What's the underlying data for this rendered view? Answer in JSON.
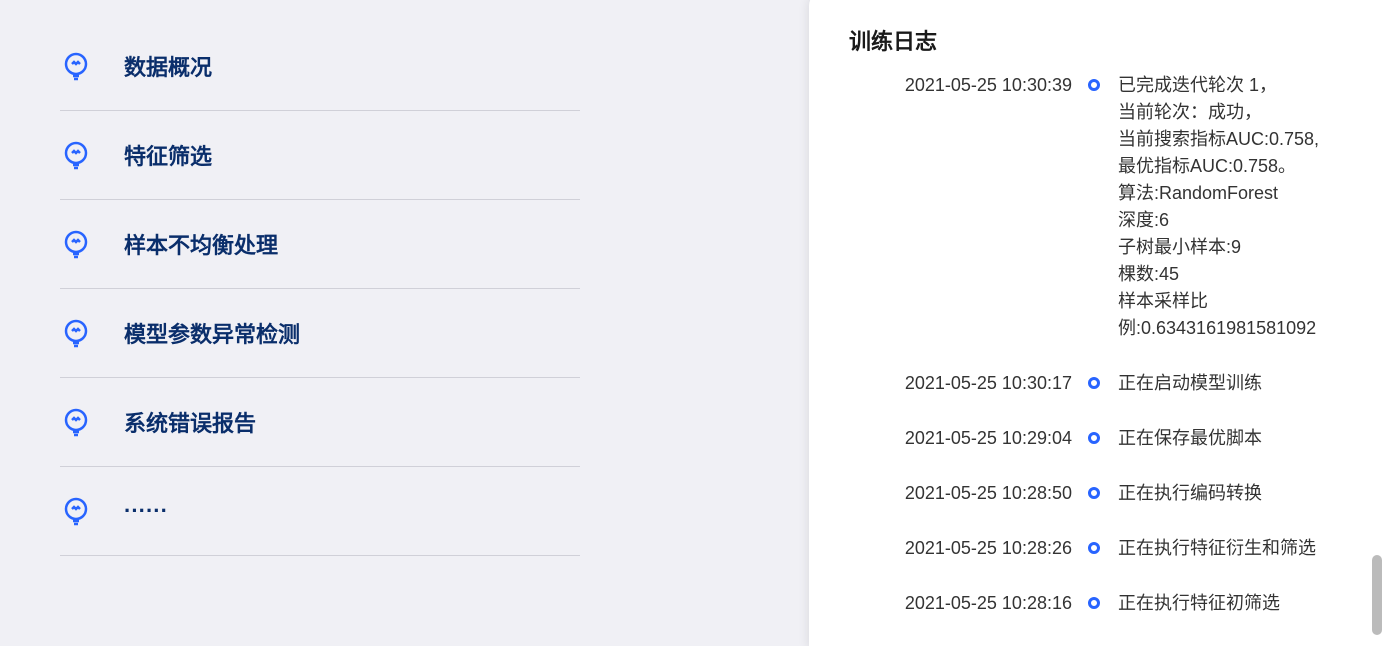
{
  "menu": {
    "items": [
      {
        "label": "数据概况"
      },
      {
        "label": "特征筛选"
      },
      {
        "label": "样本不均衡处理"
      },
      {
        "label": "模型参数异常检测"
      },
      {
        "label": "系统错误报告"
      },
      {
        "label": "······"
      }
    ]
  },
  "log_panel": {
    "title": "训练日志",
    "entries": [
      {
        "time": "2021-05-25 10:30:39",
        "msg": "已完成迭代轮次 1，\n当前轮次：成功，\n当前搜索指标AUC:0.758,\n最优指标AUC:0.758。\n算法:RandomForest\n深度:6\n子树最小样本:9\n棵数:45\n样本采样比\n例:0.6343161981581092"
      },
      {
        "time": "2021-05-25 10:30:17",
        "msg": "正在启动模型训练"
      },
      {
        "time": "2021-05-25 10:29:04",
        "msg": "正在保存最优脚本"
      },
      {
        "time": "2021-05-25 10:28:50",
        "msg": "正在执行编码转换"
      },
      {
        "time": "2021-05-25 10:28:26",
        "msg": "正在执行特征衍生和筛选"
      },
      {
        "time": "2021-05-25 10:28:16",
        "msg": "正在执行特征初筛选"
      }
    ]
  }
}
